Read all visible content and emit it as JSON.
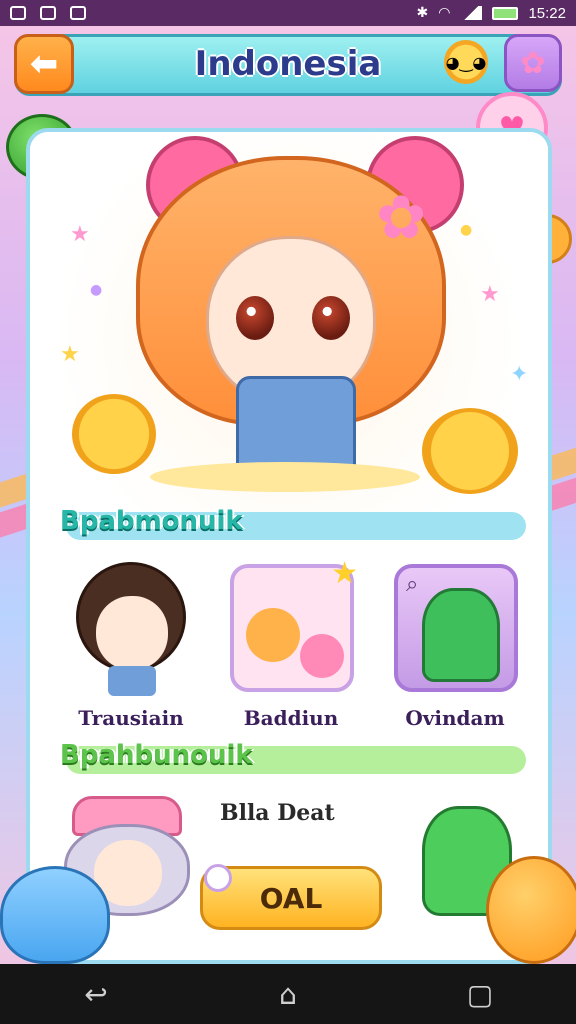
{
  "status_bar": {
    "time": "15:22",
    "icons": [
      "shield-icon",
      "photo-icon",
      "play-icon",
      "bluetooth-icon",
      "wifi-icon",
      "signal-icon",
      "battery-icon"
    ]
  },
  "header": {
    "title": "Indonesia",
    "back_icon": "arrow-left-icon",
    "right_icons": [
      "sun-icon",
      "flower-icon"
    ]
  },
  "section1": {
    "label": "Bpabmonuik",
    "items": [
      {
        "label": "Trausiain",
        "image": "brunette-girl-character"
      },
      {
        "label": "Baddiun",
        "image": "friends-card"
      },
      {
        "label": "Ovindam",
        "image": "green-monster-card"
      }
    ]
  },
  "section2": {
    "label": "Bpahbunouik",
    "item_text": "Blla Deat",
    "image": "silver-hair-girl-character"
  },
  "primary_button": {
    "label": "OAL"
  },
  "colors": {
    "accent_orange": "#ff8a1e",
    "teal": "#5fd2e0",
    "title_navy": "#2d3b8c",
    "button_yellow": "#ffb322"
  }
}
